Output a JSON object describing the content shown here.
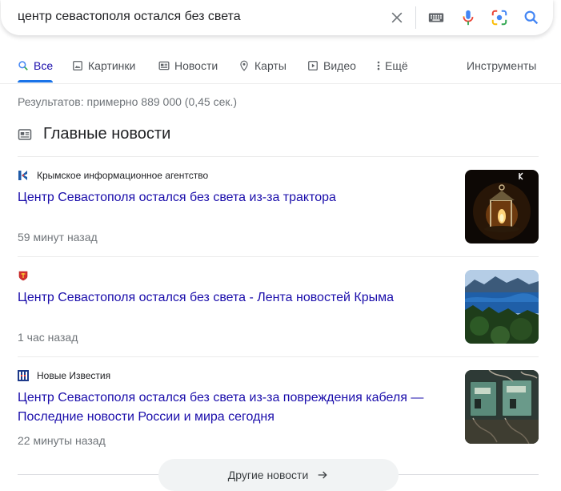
{
  "search": {
    "query": "центр севастополя остался без света"
  },
  "tabs": [
    {
      "label": "Все",
      "icon": "search-icon"
    },
    {
      "label": "Картинки",
      "icon": "image-icon"
    },
    {
      "label": "Новости",
      "icon": "news-icon"
    },
    {
      "label": "Карты",
      "icon": "map-pin-icon"
    },
    {
      "label": "Видео",
      "icon": "video-icon"
    },
    {
      "label": "Ещё",
      "icon": "more-vert-icon"
    }
  ],
  "tools_label": "Инструменты",
  "results_stats": "Результатов: примерно 889 000 (0,45 сек.)",
  "top_stories": {
    "title": "Главные новости",
    "items": [
      {
        "source": "Крымское информационное агентство",
        "headline": "Центр Севастополя остался без света из-за трактора",
        "time": "59 минут назад"
      },
      {
        "source": "",
        "headline": "Центр Севастополя остался без света - Лента новостей Крыма",
        "time": "1 час назад"
      },
      {
        "source": "Новые Известия",
        "headline": "Центр Севастополя остался без света из-за повреждения кабеля — Последние новости России и мира сегодня",
        "time": "22 минуты назад"
      }
    ],
    "more_label": "Другие новости"
  },
  "colors": {
    "link": "#1a0dab",
    "accent": "#1a73e8",
    "secondary_text": "#70757a"
  }
}
